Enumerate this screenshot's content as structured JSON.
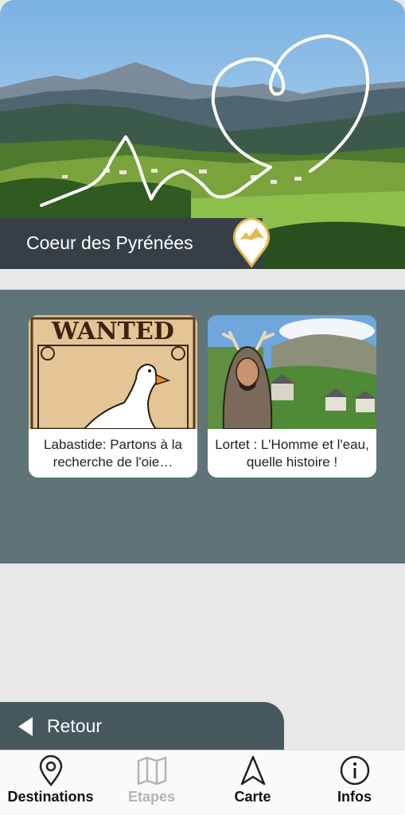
{
  "header": {
    "title": "Coeur des Pyrénées",
    "badge_icon": "mountain-location-badge-icon"
  },
  "cards": [
    {
      "caption": "Labastide: Partons à la recherche de l'oie…",
      "poster_text": "WANTED",
      "image_desc_icon": "goose-poster-image"
    },
    {
      "caption": "Lortet : L'Homme et l'eau, quelle histoire !",
      "image_desc_icon": "stag-man-village-image"
    }
  ],
  "back": {
    "label": "Retour",
    "icon": "triangle-left-icon"
  },
  "tabs": [
    {
      "label": "Destinations",
      "icon": "map-pin-icon",
      "enabled": true
    },
    {
      "label": "Etapes",
      "icon": "map-icon",
      "enabled": false
    },
    {
      "label": "Carte",
      "icon": "navigation-arrow-icon",
      "enabled": true
    },
    {
      "label": "Infos",
      "icon": "info-icon",
      "enabled": true
    }
  ],
  "colors": {
    "title_bar": "#363f45",
    "panel": "#5e7479",
    "back_bar": "#46575d",
    "badge": "#e5b94e",
    "disabled_tab": "#b4b4b4"
  }
}
